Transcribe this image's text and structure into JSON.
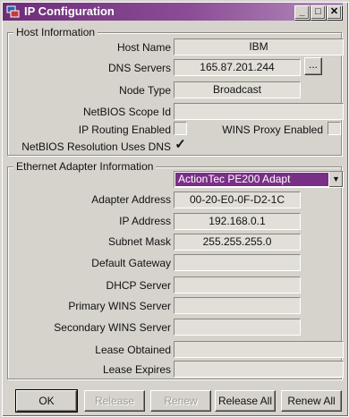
{
  "window": {
    "title": "IP Configuration"
  },
  "title_controls": {
    "minimize": "_",
    "maximize": "□",
    "close": "✕"
  },
  "host": {
    "group_label": "Host Information",
    "host_name_label": "Host Name",
    "host_name": "IBM",
    "dns_label": "DNS Servers",
    "dns": "165.87.201.244",
    "dns_more": "...",
    "node_type_label": "Node Type",
    "node_type": "Broadcast",
    "scope_label": "NetBIOS Scope Id",
    "scope": "",
    "ip_routing_label": "IP Routing Enabled",
    "ip_routing_checked": false,
    "wins_proxy_label": "WINS Proxy Enabled",
    "wins_proxy_checked": false,
    "netbios_dns_label": "NetBIOS Resolution Uses DNS",
    "netbios_dns_checked": true,
    "check_glyph": "✓"
  },
  "adapter": {
    "group_label": "Ethernet  Adapter Information",
    "selected": "ActionTec PE200 Adapt",
    "rows": [
      {
        "label": "Adapter Address",
        "value": "00-20-E0-0F-D2-1C"
      },
      {
        "label": "IP Address",
        "value": "192.168.0.1"
      },
      {
        "label": "Subnet Mask",
        "value": "255.255.255.0"
      },
      {
        "label": "Default Gateway",
        "value": ""
      },
      {
        "label": "DHCP Server",
        "value": ""
      },
      {
        "label": "Primary WINS Server",
        "value": ""
      },
      {
        "label": "Secondary WINS Server",
        "value": ""
      },
      {
        "label": "Lease Obtained",
        "value": ""
      },
      {
        "label": "Lease Expires",
        "value": ""
      }
    ]
  },
  "buttons": {
    "ok": "OK",
    "release": "Release",
    "renew": "Renew",
    "release_all": "Release All",
    "renew_all": "Renew All"
  },
  "colors": {
    "title_start": "#6d2d79",
    "title_end": "#b58cbb",
    "selection": "#7a2f86"
  }
}
